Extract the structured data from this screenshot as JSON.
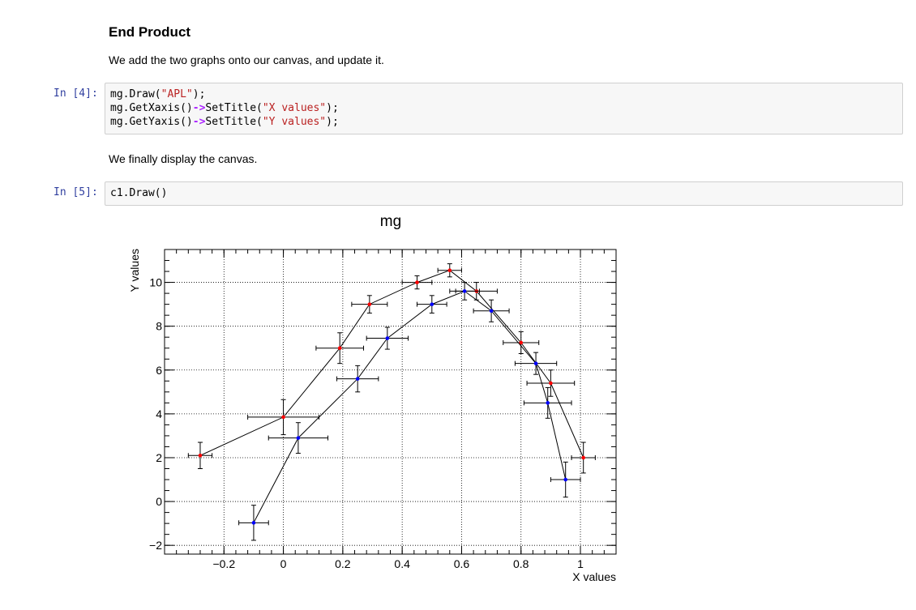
{
  "markdown": {
    "heading": "End Product",
    "para1": "We add the two graphs onto our canvas, and update it.",
    "para2": "We finally display the canvas."
  },
  "cells": [
    {
      "prompt": "In [4]:",
      "lines": [
        {
          "pre": "mg.Draw(",
          "str": "\"APL\"",
          "arrow": "",
          "post": ");"
        },
        {
          "pre": "mg.GetXaxis()",
          "arrow": "->",
          "mid": "SetTitle(",
          "str": "\"X values\"",
          "post": ");"
        },
        {
          "pre": "mg.GetYaxis()",
          "arrow": "->",
          "mid": "SetTitle(",
          "str": "\"Y values\"",
          "post": ");"
        }
      ]
    },
    {
      "prompt": "In [5]:",
      "code": "c1.Draw()"
    }
  ],
  "chart_data": {
    "type": "scatter",
    "title": "mg",
    "xlabel": "X values",
    "ylabel": "Y values",
    "xlim": [
      -0.4,
      1.12
    ],
    "ylim": [
      -2.4,
      11.5
    ],
    "xticks": [
      -0.2,
      0,
      0.2,
      0.4,
      0.6,
      0.8,
      1
    ],
    "xtick_labels": [
      "−0.2",
      "0",
      "0.2",
      "0.4",
      "0.6",
      "0.8",
      "1"
    ],
    "yticks": [
      -2,
      0,
      2,
      4,
      6,
      8,
      10
    ],
    "ytick_labels": [
      "−2",
      "0",
      "2",
      "4",
      "6",
      "8",
      "10"
    ],
    "grid": true,
    "series": [
      {
        "color": "#ff0000",
        "points": [
          {
            "x": -0.28,
            "y": 2.1,
            "ex": 0.04,
            "ey": 0.6
          },
          {
            "x": 0.0,
            "y": 3.85,
            "ex": 0.12,
            "ey": 0.8
          },
          {
            "x": 0.19,
            "y": 7.0,
            "ex": 0.08,
            "ey": 0.7
          },
          {
            "x": 0.29,
            "y": 9.0,
            "ex": 0.06,
            "ey": 0.4
          },
          {
            "x": 0.45,
            "y": 10.0,
            "ex": 0.05,
            "ey": 0.3
          },
          {
            "x": 0.56,
            "y": 10.55,
            "ex": 0.04,
            "ey": 0.3
          },
          {
            "x": 0.65,
            "y": 9.6,
            "ex": 0.07,
            "ey": 0.4
          },
          {
            "x": 0.8,
            "y": 7.25,
            "ex": 0.06,
            "ey": 0.5
          },
          {
            "x": 0.9,
            "y": 5.4,
            "ex": 0.08,
            "ey": 0.6
          },
          {
            "x": 1.01,
            "y": 2.0,
            "ex": 0.04,
            "ey": 0.7
          }
        ]
      },
      {
        "color": "#0000ff",
        "points": [
          {
            "x": -0.1,
            "y": -0.97,
            "ex": 0.05,
            "ey": 0.8
          },
          {
            "x": 0.05,
            "y": 2.9,
            "ex": 0.1,
            "ey": 0.7
          },
          {
            "x": 0.25,
            "y": 5.6,
            "ex": 0.07,
            "ey": 0.6
          },
          {
            "x": 0.35,
            "y": 7.45,
            "ex": 0.07,
            "ey": 0.5
          },
          {
            "x": 0.5,
            "y": 9.0,
            "ex": 0.05,
            "ey": 0.4
          },
          {
            "x": 0.61,
            "y": 9.6,
            "ex": 0.05,
            "ey": 0.4
          },
          {
            "x": 0.7,
            "y": 8.7,
            "ex": 0.06,
            "ey": 0.5
          },
          {
            "x": 0.85,
            "y": 6.3,
            "ex": 0.07,
            "ey": 0.5
          },
          {
            "x": 0.89,
            "y": 4.5,
            "ex": 0.08,
            "ey": 0.7
          },
          {
            "x": 0.95,
            "y": 1.0,
            "ex": 0.05,
            "ey": 0.8
          }
        ]
      }
    ]
  }
}
